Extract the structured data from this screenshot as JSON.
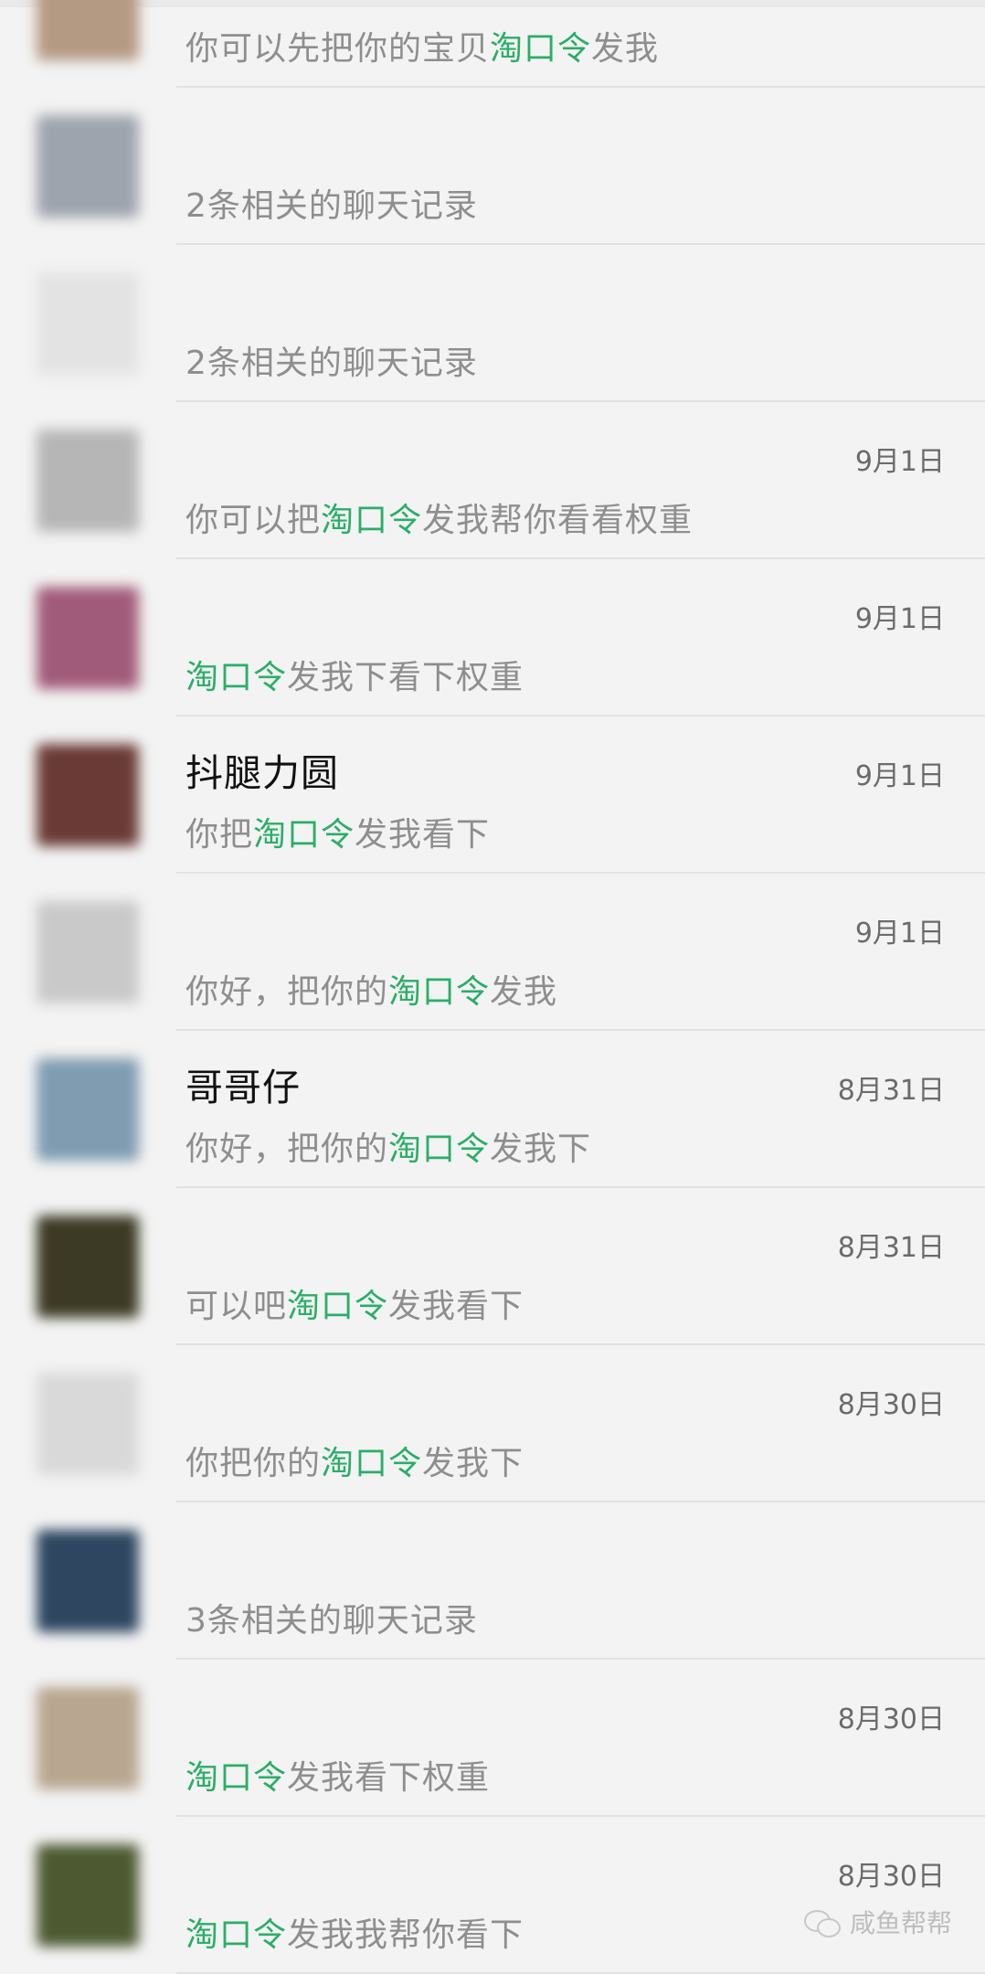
{
  "chats": [
    {
      "name": "",
      "name_blurred": true,
      "preview_prefix": "你可以先把你的宝贝",
      "keyword": "淘口令",
      "preview_suffix": "发我",
      "date": "",
      "avatar": "#b49a83"
    },
    {
      "name": "",
      "name_blurred": true,
      "preview_prefix": "2条相关的聊天记录",
      "keyword": "",
      "preview_suffix": "",
      "date": "",
      "avatar": "#9ea4ad"
    },
    {
      "name": "",
      "name_blurred": true,
      "preview_prefix": "2条相关的聊天记录",
      "keyword": "",
      "preview_suffix": "",
      "date": "",
      "avatar": "#e3e3e3"
    },
    {
      "name": "",
      "name_blurred": true,
      "preview_prefix": "你可以把",
      "keyword": "淘口令",
      "preview_suffix": "发我帮你看看权重",
      "date": "9月1日",
      "avatar": "#b6b6b6"
    },
    {
      "name": "",
      "name_blurred": true,
      "preview_prefix": "",
      "keyword": "淘口令",
      "preview_suffix": "发我下看下权重",
      "date": "9月1日",
      "avatar": "#a15b7a"
    },
    {
      "name": "抖腿力圆",
      "name_blurred": false,
      "preview_prefix": "你把",
      "keyword": "淘口令",
      "preview_suffix": "发我看下",
      "date": "9月1日",
      "avatar": "#6a3b36"
    },
    {
      "name": "",
      "name_blurred": true,
      "preview_prefix": "你好，把你的",
      "keyword": "淘口令",
      "preview_suffix": "发我",
      "date": "9月1日",
      "avatar": "#c9c9c9"
    },
    {
      "name": "哥哥仔",
      "name_blurred": false,
      "preview_prefix": "你好，把你的",
      "keyword": "淘口令",
      "preview_suffix": "发我下",
      "date": "8月31日",
      "avatar": "#7f9cb1"
    },
    {
      "name": "",
      "name_blurred": true,
      "preview_prefix": "可以吧",
      "keyword": "淘口令",
      "preview_suffix": "发我看下",
      "date": "8月31日",
      "avatar": "#3c3a24"
    },
    {
      "name": "",
      "name_blurred": true,
      "preview_prefix": "你把你的",
      "keyword": "淘口令",
      "preview_suffix": "发我下",
      "date": "8月30日",
      "avatar": "#d9d9d9"
    },
    {
      "name": "",
      "name_blurred": true,
      "preview_prefix": "3条相关的聊天记录",
      "keyword": "",
      "preview_suffix": "",
      "date": "",
      "avatar": "#2e4660"
    },
    {
      "name": "",
      "name_blurred": true,
      "preview_prefix": "",
      "keyword": "淘口令",
      "preview_suffix": "发我看下权重",
      "date": "8月30日",
      "avatar": "#b8a690"
    },
    {
      "name": "",
      "name_blurred": true,
      "preview_prefix": "",
      "keyword": "淘口令",
      "preview_suffix": "发我我帮你看下",
      "date": "8月30日",
      "avatar": "#4d5a31"
    }
  ],
  "watermark": {
    "icon": "wechat-icon",
    "text": "咸鱼帮帮"
  },
  "colors": {
    "keyword": "#2aae67",
    "background": "#f3f3f3"
  }
}
